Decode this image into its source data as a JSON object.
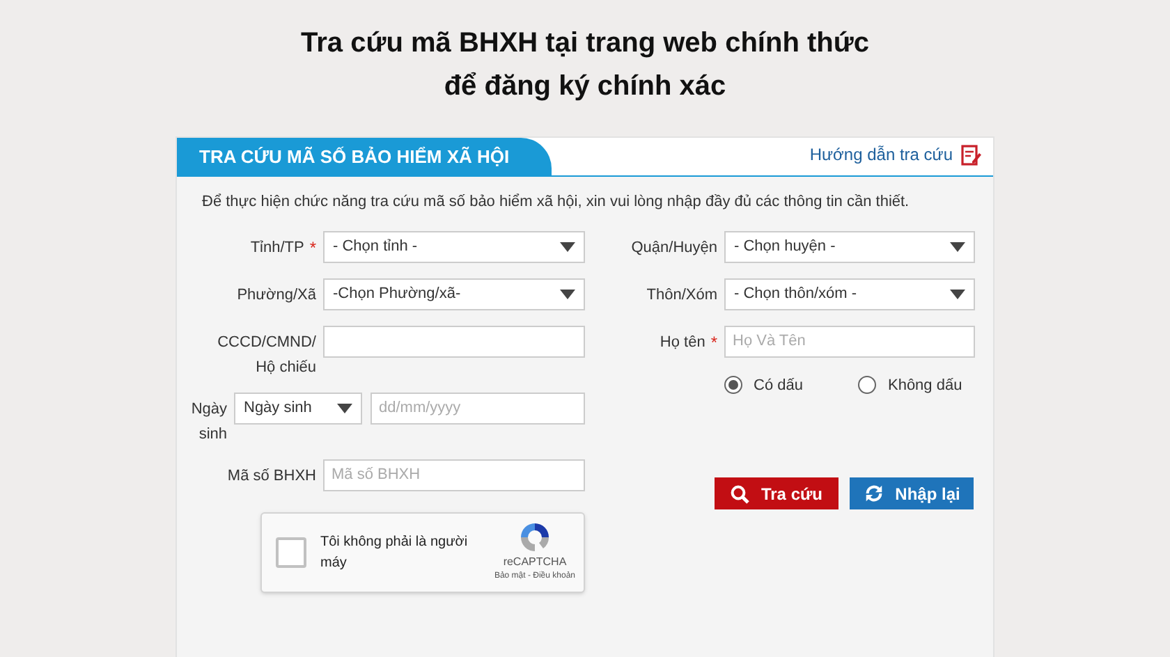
{
  "heading": [
    "Tra cứu mã BHXH tại trang web chính thức",
    "để đăng ký chính xác"
  ],
  "panel": {
    "title": "TRA CỨU MÃ SỐ BẢO HIỂM XÃ HỘI",
    "help_link": "Hướng dẫn tra cứu",
    "intro": "Để thực hiện chức năng tra cứu mã số bảo hiểm xã hội, xin vui lòng nhập đầy đủ các thông tin cần thiết."
  },
  "left_fields": [
    {
      "label": "Tỉnh/TP",
      "required_mark": "*",
      "controls": [
        {
          "kind": "select",
          "value": "- Chọn tỉnh -"
        }
      ]
    },
    {
      "label": "Phường/Xã",
      "controls": [
        {
          "kind": "select",
          "value": "-Chọn Phường/xã-"
        }
      ]
    },
    {
      "label": "CCCD/CMND/ Hộ chiếu",
      "controls": [
        {
          "kind": "input"
        }
      ]
    },
    {
      "label": "Ngày sinh",
      "controls": [
        {
          "kind": "select",
          "value": "Ngày sinh"
        },
        {
          "kind": "input",
          "placeholder": "dd/mm/yyyy"
        }
      ]
    },
    {
      "label": "Mã số BHXH",
      "controls": [
        {
          "kind": "input",
          "placeholder": "Mã số BHXH"
        }
      ]
    }
  ],
  "right_fields": [
    {
      "label": "Quận/Huyện",
      "controls": [
        {
          "kind": "select",
          "value": "- Chọn huyện -"
        }
      ]
    },
    {
      "label": "Thôn/Xóm",
      "controls": [
        {
          "kind": "select",
          "value": "- Chọn thôn/xóm -"
        }
      ]
    },
    {
      "label": "Họ tên",
      "required_mark": "*",
      "controls": [
        {
          "kind": "input",
          "placeholder": "Họ Và Tên"
        }
      ]
    }
  ],
  "name_options": [
    {
      "label": "Có dấu",
      "selected": true
    },
    {
      "label": "Không dấu",
      "selected": false
    }
  ],
  "captcha": {
    "label": "Tôi không phải là người máy",
    "checked": false,
    "brand": "reCAPTCHA",
    "links": "Bảo mật - Điều khoản"
  },
  "buttons": [
    {
      "kind": "search",
      "label": "Tra cứu"
    },
    {
      "kind": "reset",
      "label": "Nhập lại"
    }
  ]
}
